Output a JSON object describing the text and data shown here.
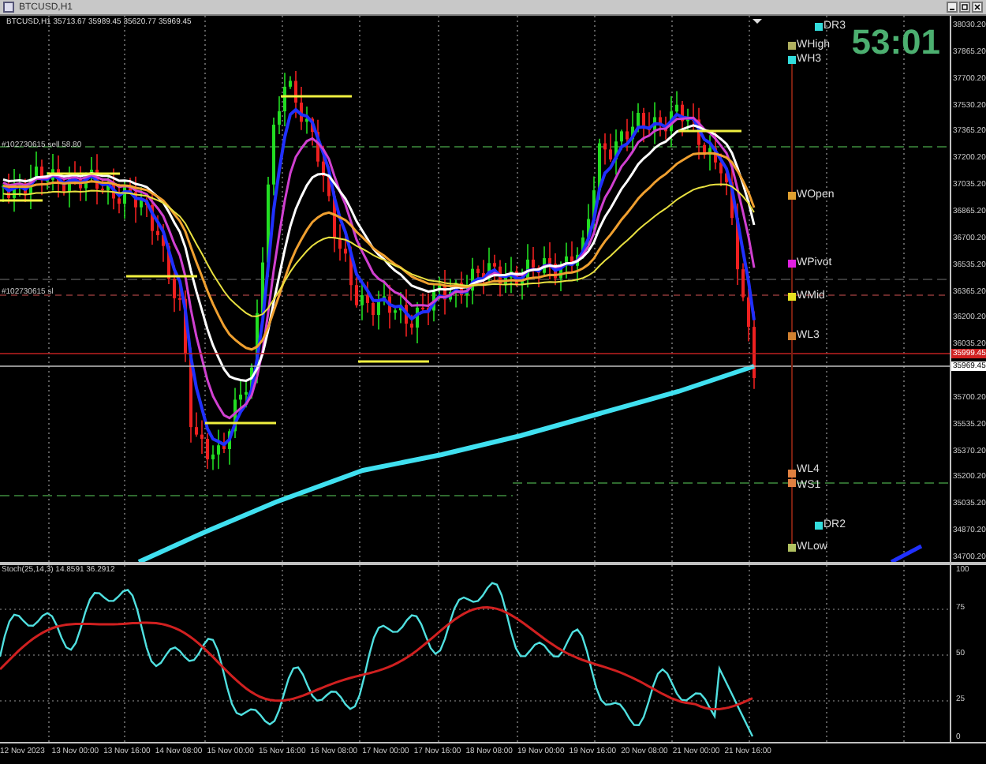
{
  "window": {
    "title": "BTCUSD,H1"
  },
  "chart": {
    "header": "BTCUSD,H1  35713.67 35989.45 35620.77 35969.45",
    "timer": "53:01",
    "order_labels": [
      "#102730615 sell 58.80",
      "#102730615 sl"
    ],
    "price_axis": [
      "38030.20",
      "37865.20",
      "37700.20",
      "37530.20",
      "37365.20",
      "37200.20",
      "37035.20",
      "36865.20",
      "36700.20",
      "36535.20",
      "36365.20",
      "36200.20",
      "36035.20",
      "35700.20",
      "35535.20",
      "35370.20",
      "35200.20",
      "35035.20",
      "34870.20",
      "34700.20"
    ],
    "ask_tag": "35999.45",
    "bid_tag": "35969.45",
    "pivots": [
      {
        "label": "DR3",
        "color": "#33dddd"
      },
      {
        "label": "WHigh",
        "color": "#b0b060"
      },
      {
        "label": "WH3",
        "color": "#33dddd"
      },
      {
        "label": "WOpen",
        "color": "#e0a030"
      },
      {
        "label": "WPivot",
        "color": "#e020e0"
      },
      {
        "label": "WMid",
        "color": "#e8e020"
      },
      {
        "label": "WL3",
        "color": "#d08030"
      },
      {
        "label": "WL4",
        "color": "#e08040"
      },
      {
        "label": "WS1",
        "color": "#e08040"
      },
      {
        "label": "DR2",
        "color": "#33dddd"
      },
      {
        "label": "WLow",
        "color": "#b0c060"
      }
    ]
  },
  "indicator": {
    "label": "Stoch(25,14,3) 14.8591 36.2912",
    "axis": [
      "100",
      "75",
      "50",
      "25",
      "0"
    ]
  },
  "time_axis": [
    "12 Nov 2023",
    "13 Nov 00:00",
    "13 Nov 16:00",
    "14 Nov 08:00",
    "15 Nov 00:00",
    "15 Nov 16:00",
    "16 Nov 08:00",
    "17 Nov 00:00",
    "17 Nov 16:00",
    "18 Nov 08:00",
    "19 Nov 00:00",
    "19 Nov 16:00",
    "20 Nov 08:00",
    "21 Nov 00:00",
    "21 Nov 16:00"
  ]
}
